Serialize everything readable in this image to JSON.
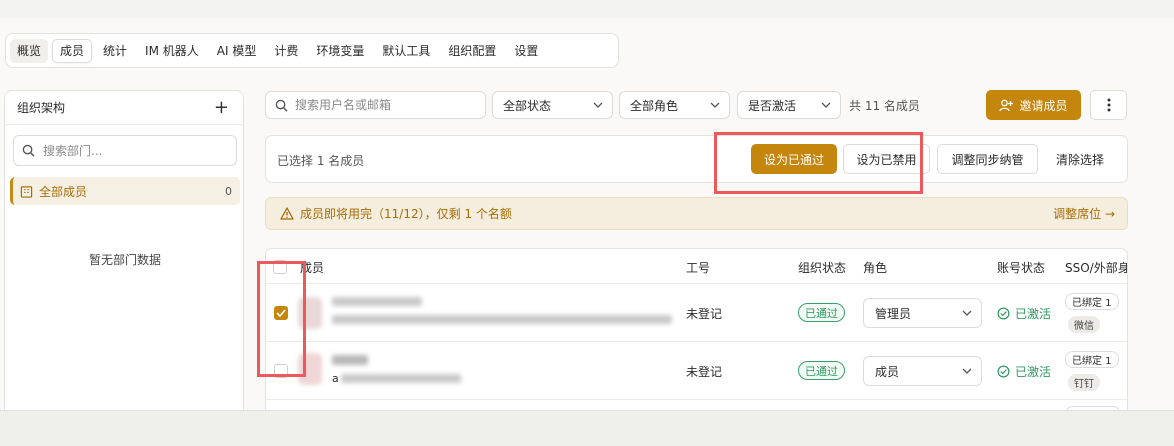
{
  "tabs": [
    {
      "label": "概览"
    },
    {
      "label": "成员"
    },
    {
      "label": "统计"
    },
    {
      "label": "IM 机器人"
    },
    {
      "label": "AI 模型"
    },
    {
      "label": "计费"
    },
    {
      "label": "环境变量"
    },
    {
      "label": "默认工具"
    },
    {
      "label": "组织配置"
    },
    {
      "label": "设置"
    }
  ],
  "sidebar": {
    "title": "组织架构",
    "search_placeholder": "搜索部门...",
    "all_members_label": "全部成员",
    "all_members_count": "0",
    "empty_text": "暂无部门数据"
  },
  "filters": {
    "search_placeholder": "搜索用户名或邮箱",
    "status": "全部状态",
    "role": "全部角色",
    "activation": "是否激活",
    "total_text": "共 11 名成员",
    "invite_label": "邀请成员"
  },
  "selection": {
    "text": "已选择 1 名成员",
    "approve_label": "设为已通过",
    "disable_label": "设为已禁用",
    "sync_label": "调整同步纳管",
    "clear_label": "清除选择"
  },
  "warning": {
    "text": "成员即将用完（11/12），仅剩 1 个名额",
    "link": "调整席位 →"
  },
  "table": {
    "headers": {
      "member": "成员",
      "employee_id": "工号",
      "org_status": "组织状态",
      "role": "角色",
      "account_status": "账号状态",
      "sso": "SSO/外部身"
    },
    "rows": [
      {
        "checked": true,
        "employee_id": "未登记",
        "org_status": "已通过",
        "role": "管理员",
        "account_status": "已激活",
        "sso_bound": "已绑定 1",
        "sso_provider": "微信"
      },
      {
        "checked": false,
        "employee_id": "未登记",
        "org_status": "已通过",
        "role": "成员",
        "account_status": "已激活",
        "sso_bound": "已绑定 1",
        "sso_provider": "钉钉",
        "email_prefix": "a"
      }
    ]
  },
  "colors": {
    "accent": "#c4860d",
    "success": "#2f9a60",
    "highlight_box": "#ea5a5d",
    "warning_bg": "#f5edde"
  }
}
